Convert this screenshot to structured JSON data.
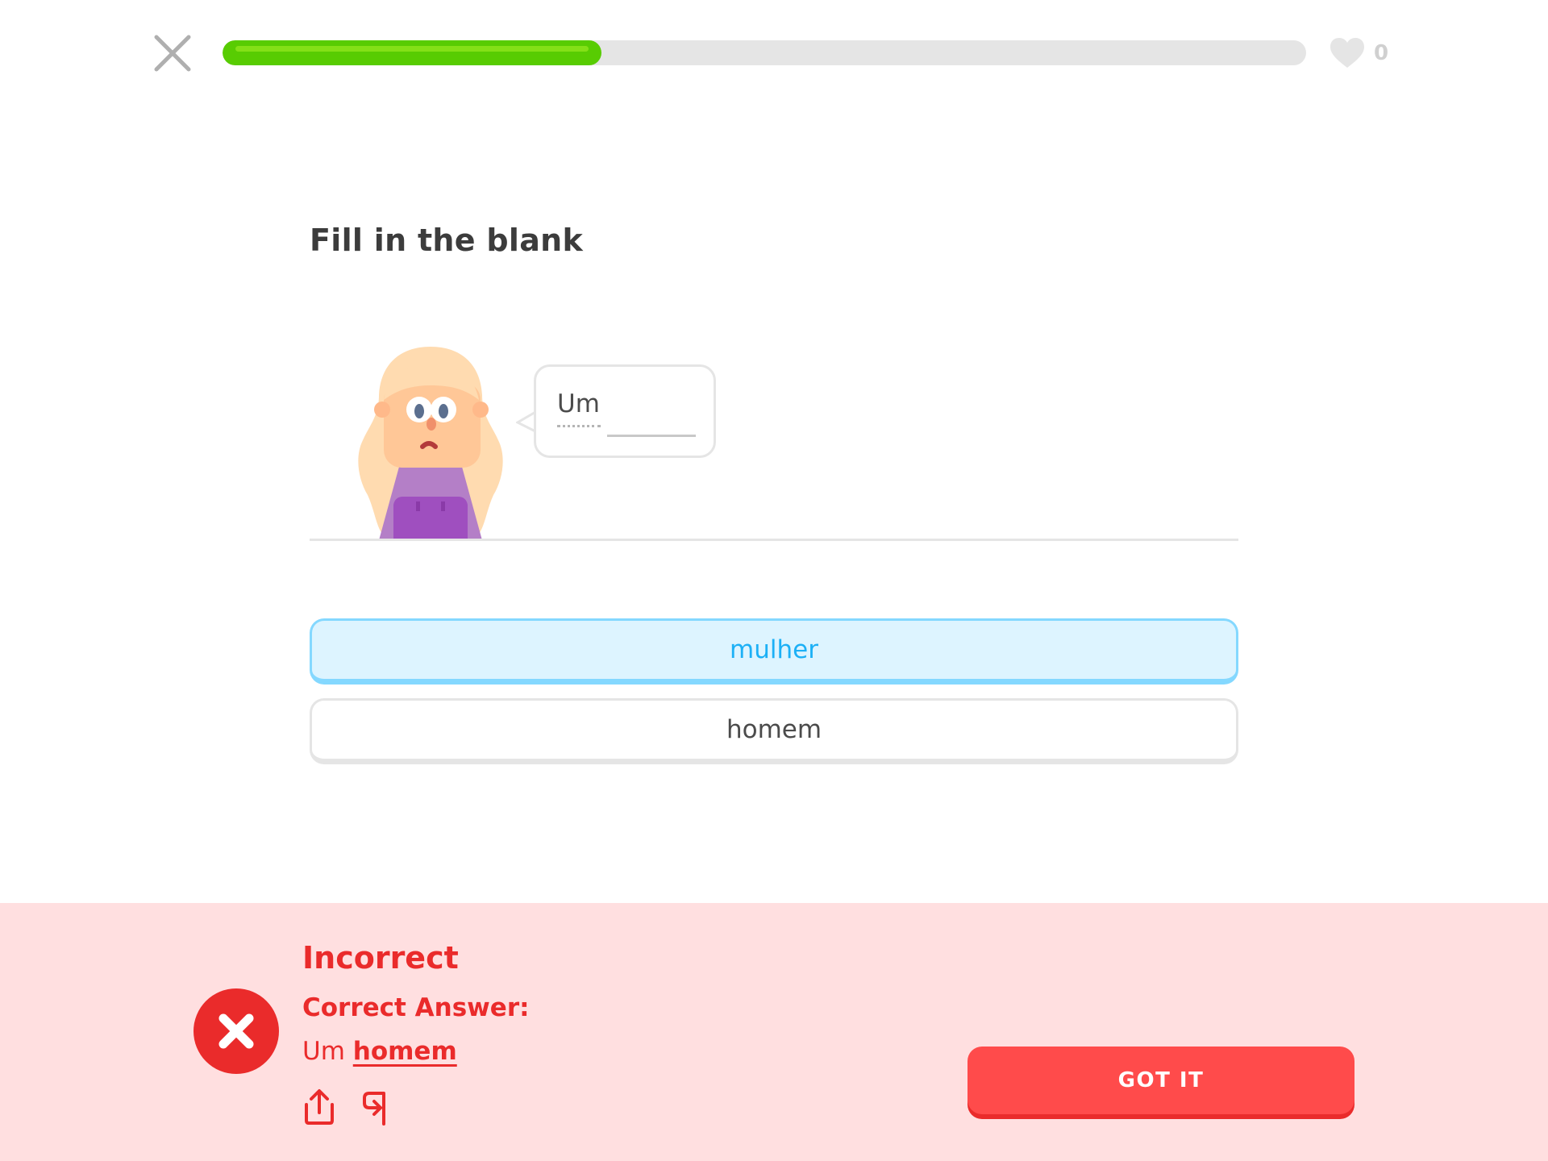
{
  "header": {
    "close_icon": "close-icon",
    "progress": 0.35,
    "hearts_icon": "heart-icon",
    "hearts_count": "0"
  },
  "prompt": {
    "title": "Fill in the blank"
  },
  "dialogue": {
    "character": "woman-character",
    "word": "Um"
  },
  "options": [
    {
      "label": "mulher",
      "selected": true
    },
    {
      "label": "homem",
      "selected": false
    }
  ],
  "feedback": {
    "title": "Incorrect",
    "answer_label": "Correct Answer:",
    "answer_prefix": "Um ",
    "answer_word": "homem",
    "status_icon": "x-circle-icon",
    "share_icon": "share-icon",
    "report_icon": "flag-icon",
    "button_label": "GOT IT"
  },
  "colors": {
    "progress": "#58cc02",
    "selected_option": "#1cb0f6",
    "error": "#ea2b2b",
    "feedback_bg": "#ffdfe0",
    "button": "#ff4b4b"
  }
}
